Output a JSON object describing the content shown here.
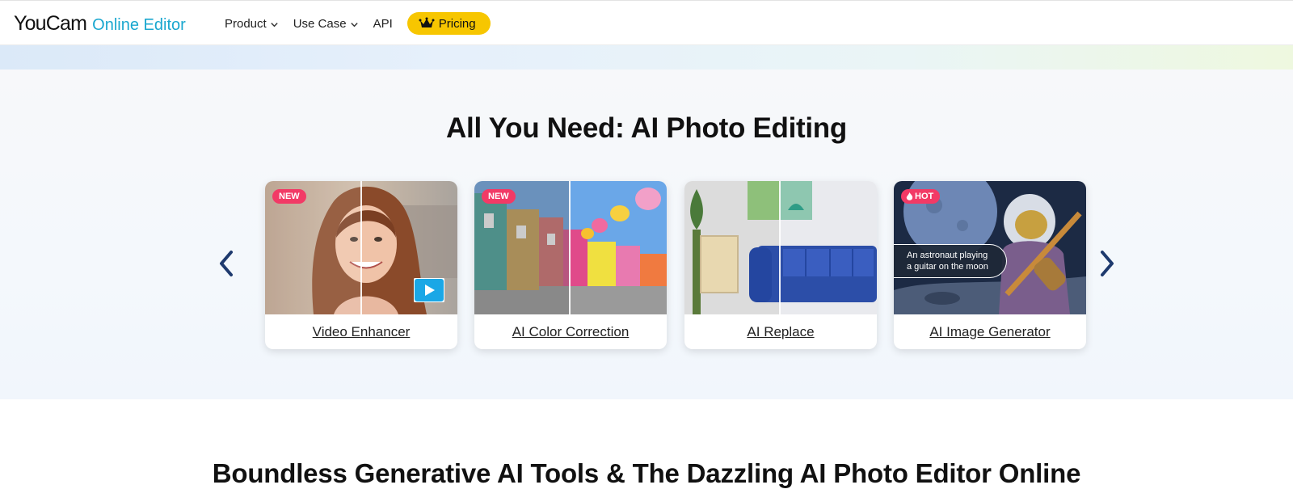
{
  "header": {
    "logo_brand": "YouCam",
    "logo_product": "Online Editor",
    "nav": {
      "product": "Product",
      "use_case": "Use Case",
      "api": "API",
      "pricing": "Pricing"
    }
  },
  "section": {
    "title": "All You Need: AI Photo Editing",
    "cards": [
      {
        "label": "Video Enhancer",
        "badge": "NEW"
      },
      {
        "label": "AI Color Correction",
        "badge": "NEW"
      },
      {
        "label": "AI Replace",
        "badge": ""
      },
      {
        "label": "AI Image Generator",
        "badge": "HOT",
        "bubble_line1": "An astronaut playing",
        "bubble_line2": "a guitar on the moon"
      }
    ]
  },
  "bottom": {
    "title": "Boundless Generative AI Tools & The Dazzling AI Photo Editor Online"
  },
  "colors": {
    "accent_blue": "#1aa7cf",
    "pricing_yellow": "#f7c600",
    "badge_pink": "#f23a66",
    "arrow_navy": "#1e3a6e"
  },
  "icons": {
    "nav_chevron": "chevron-down-icon",
    "pricing": "crown-icon",
    "carousel_prev": "chevron-left-icon",
    "carousel_next": "chevron-right-icon",
    "video": "play-icon",
    "hot": "flame-icon"
  }
}
